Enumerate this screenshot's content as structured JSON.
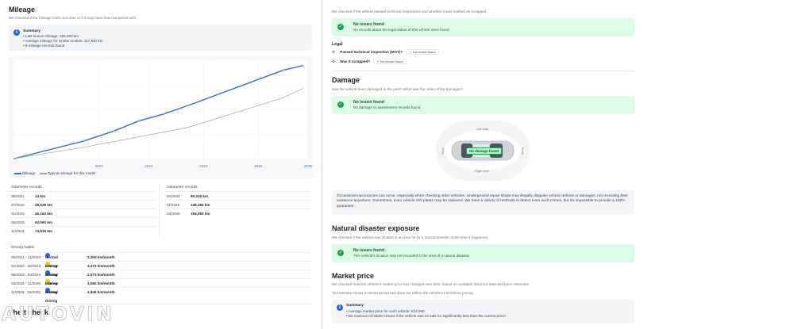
{
  "mileage": {
    "title": "Mileage",
    "subtitle": "We checked if the mileage looks accurate or if it may have been tampered with.",
    "summary": {
      "title": "Summary",
      "lines": [
        "Last known mileage: 156,063 km",
        "Average mileage for similar models: 117,940 km",
        "8 mileage records found"
      ]
    },
    "chart": {
      "x_ticks": [
        "2023",
        "2023",
        "2024",
        "2025",
        "2026"
      ],
      "legend": [
        "Mileage",
        "Typical mileage for this model"
      ]
    },
    "odometer_left": {
      "header": "Odometer records",
      "rows": [
        {
          "date": "05/2021",
          "km": "14 km"
        },
        {
          "date": "07/2022",
          "km": "29,538 km"
        },
        {
          "date": "01/2023",
          "km": "46,163 km"
        },
        {
          "date": "06/2023",
          "km": "63,060 km"
        },
        {
          "date": "11/2023",
          "km": "74,819 km"
        }
      ]
    },
    "odometer_right": {
      "header": "Odometer records",
      "rows": [
        {
          "date": "04/2024",
          "km": "89,229 km"
        },
        {
          "date": "11/2025",
          "km": "148,180 km"
        },
        {
          "date": "03/2026",
          "km": "156,063 km"
        }
      ]
    },
    "habits": {
      "header": "Driving habits",
      "rows": [
        {
          "period": "05/2021 - 11/2023",
          "label": "Normal driving",
          "rate": "2,300 km/month",
          "color": "#2563eb"
        },
        {
          "period": "01/2023 - 06/2023",
          "label": "Intense driving",
          "rate": "3,272 km/month",
          "color": "#f5c518"
        },
        {
          "period": "06/2023 - 04/2024",
          "label": "Normal driving",
          "rate": "2,573 km/month",
          "color": "#2563eb"
        },
        {
          "period": "04/2024 - 11/2025",
          "label": "Intense driving",
          "rate": "3,060 km/month",
          "color": "#f5c518"
        },
        {
          "period": "11/2025 - 03/2026",
          "label": "Normal driving",
          "rate": "1,846 km/month",
          "color": "#2563eb"
        }
      ]
    },
    "bottom_heading": "Theft check",
    "watermark": "AUTOVIN"
  },
  "legal": {
    "intro": "We checked if the vehicle passed technical inspections and whether it was marked as scrapped.",
    "ok": {
      "title": "No issues found",
      "desc": "No records about the legal status of this vehicle were found"
    },
    "heading": "Legal",
    "items": [
      {
        "label": "Passed technical inspection (MOT)?",
        "value": "No record found",
        "icon": "inspection-icon"
      },
      {
        "label": "Was it scrapped?",
        "value": "No record found",
        "icon": "recycle-icon"
      }
    ]
  },
  "damage": {
    "title": "Damage",
    "subtitle": "Has the vehicle been damaged in the past? What was the value of the damages?",
    "ok": {
      "title": "No issues found",
      "desc": "No damage or assessment records found"
    },
    "diagram": {
      "left_side": "Left side",
      "right_side": "Right side",
      "rear": "Rear",
      "front": "Front",
      "badge": "No damage found"
    },
    "note": "Occasional inaccuracies can occur, especially when checking older vehicles. Underground repair shops may illegally disguise vehicle defects or damages, not recording their existence anywhere. Sometimes, even vehicle VIN plates may be replaced. We have a variety of methods to detect even such crimes, but it's impossible to provide a 100% guarantee."
  },
  "natural": {
    "title": "Natural disaster exposure",
    "subtitle": "We checked if the vehicle was located in an area hit by a natural disaster at the time it happened.",
    "ok": {
      "title": "No issues found",
      "desc": "This vehicle's location was not recorded in the area of a natural disaster."
    }
  },
  "market": {
    "title": "Market price",
    "subtitle": "We checked how this vehicle's market price has changed over time, based on available historical data and price estimates.",
    "subtitle2": "The timeline shows a limited period and does not reflect the vehicle's full lifetime pricing.",
    "summary": {
      "title": "Summary",
      "lines": [
        "Average market price for such vehicle: €24,990",
        "Be cautious of hidden issues if the vehicle was on sale for significantly less than the current price!"
      ]
    }
  },
  "chart_data": {
    "type": "line",
    "x": [
      "2021-05",
      "2022-07",
      "2023-01",
      "2023-06",
      "2023-11",
      "2024-04",
      "2025-11",
      "2026-03"
    ],
    "series": [
      {
        "name": "Mileage",
        "values": [
          14,
          29538,
          46163,
          63060,
          74819,
          89229,
          148180,
          156063
        ]
      },
      {
        "name": "Typical mileage for this model",
        "values": [
          0,
          19000,
          28500,
          36500,
          44500,
          52500,
          102000,
          117940
        ]
      }
    ],
    "x_tick_labels": [
      "2023",
      "2023",
      "2024",
      "2025",
      "2026"
    ],
    "grid": true,
    "legend": "bottom-left",
    "colors": {
      "mileage": "#2f6fd6",
      "typical": "#a3a3a3"
    }
  }
}
